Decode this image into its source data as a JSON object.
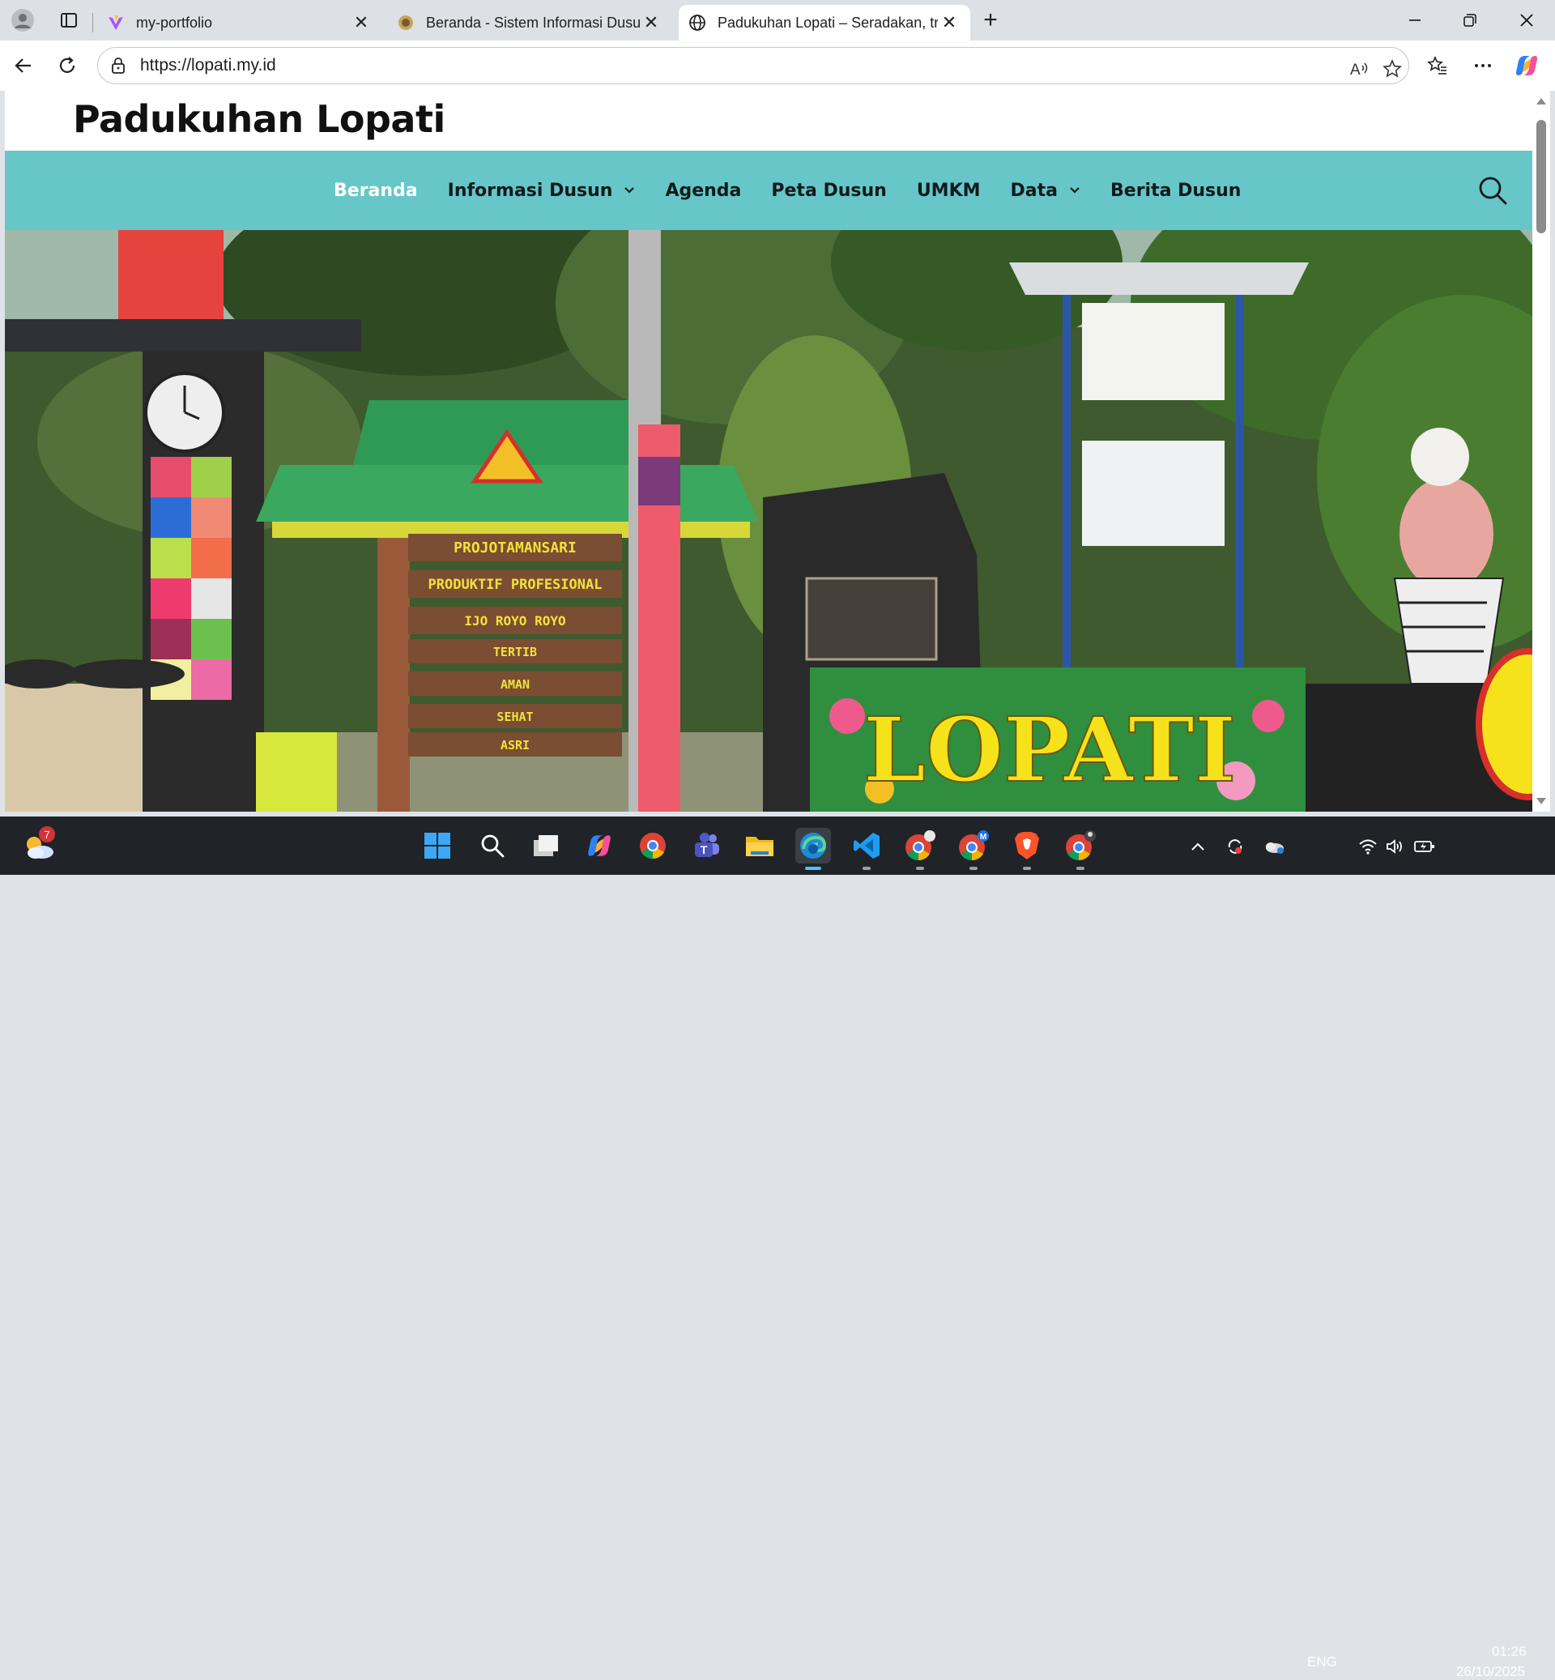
{
  "browser": {
    "tabs": [
      {
        "title": "my-portfolio",
        "favicon": "vite-icon"
      },
      {
        "title": "Beranda - Sistem Informasi Dusun",
        "favicon": "emblem-icon"
      },
      {
        "title": "Padukuhan Lopati – Seradakan, tr",
        "favicon": "globe-icon",
        "active": true
      }
    ],
    "url": "https://lopati.my.id"
  },
  "site": {
    "title": "Padukuhan Lopati",
    "accent_color": "#67c6c8",
    "menu": [
      {
        "label": "Beranda",
        "active": true
      },
      {
        "label": "Informasi Dusun",
        "dropdown": true
      },
      {
        "label": "Agenda"
      },
      {
        "label": "Peta Dusun"
      },
      {
        "label": "UMKM"
      },
      {
        "label": "Data",
        "dropdown": true
      },
      {
        "label": "Berita Dusun"
      }
    ]
  },
  "hero": {
    "signs": [
      "PROJOTAMANSARI",
      "PRODUKTIF PROFESIONAL",
      "IJO ROYO ROYO",
      "TERTIB",
      "AMAN",
      "SEHAT",
      "ASRI"
    ],
    "monument_text": "LOPATI"
  },
  "taskbar": {
    "weather_badge": "7",
    "language": "ENG",
    "time": "01:26",
    "date": "26/10/2025"
  }
}
